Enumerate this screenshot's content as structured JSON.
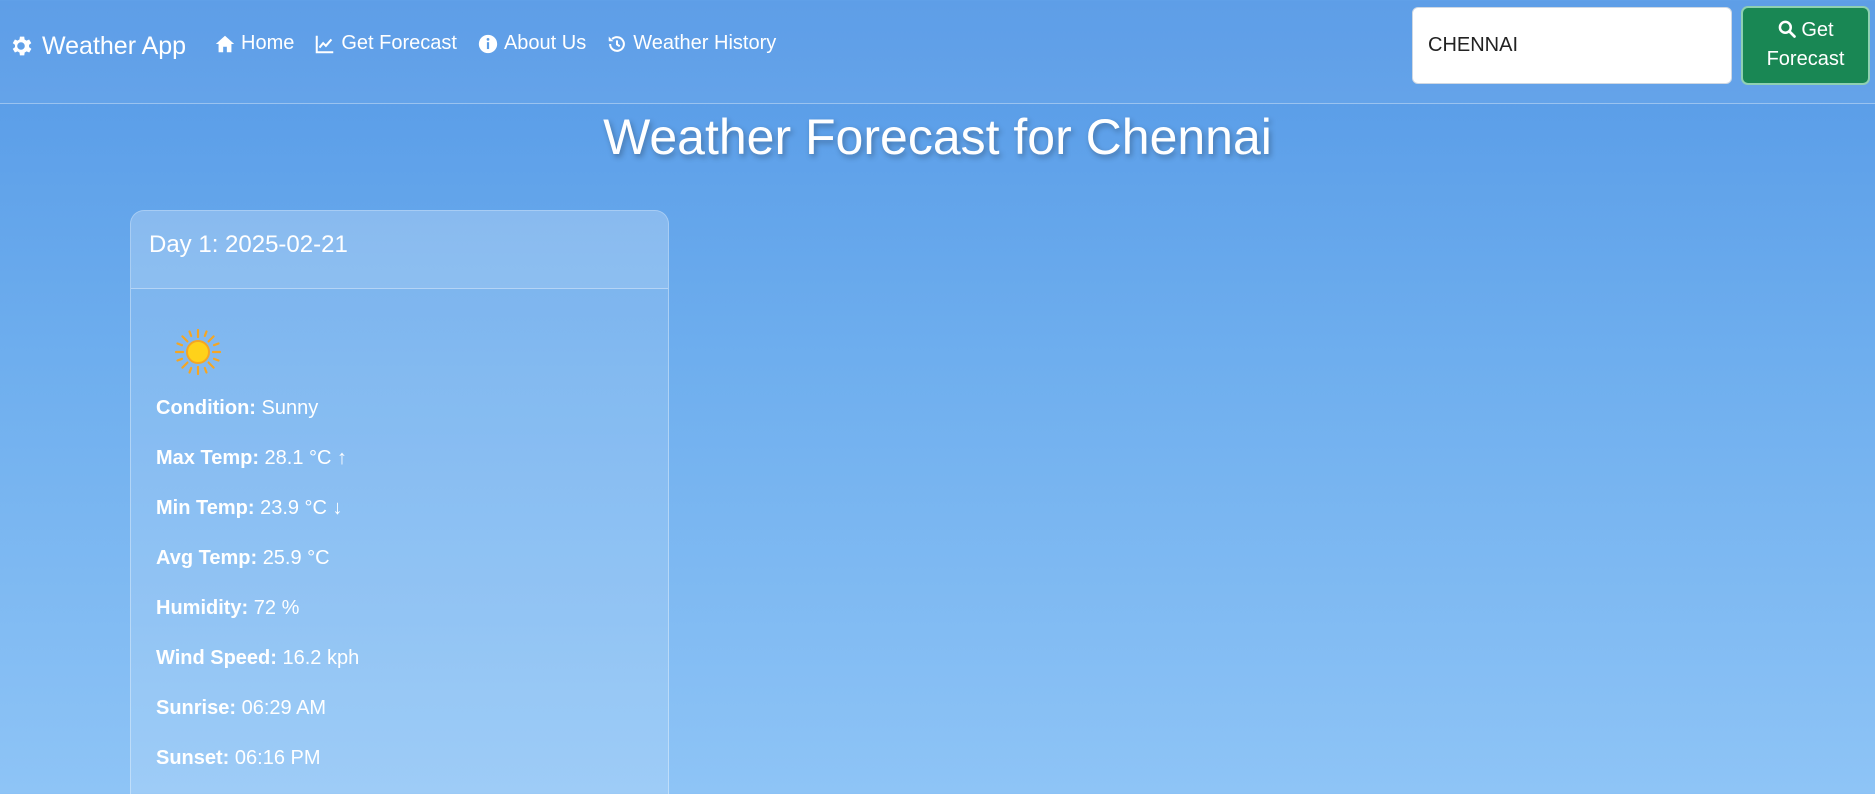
{
  "nav": {
    "brand": "Weather App",
    "links": [
      "Home",
      "Get Forecast",
      "About Us",
      "Weather History"
    ],
    "search_value": "CHENNAI",
    "button_label_line1": "Get",
    "button_label_line2": "Forecast"
  },
  "page": {
    "title": "Weather Forecast for Chennai"
  },
  "forecast": {
    "day_title": "Day 1: 2025-02-21",
    "icon": "sun-icon",
    "rows": [
      {
        "label": "Condition:",
        "value": "Sunny"
      },
      {
        "label": "Max Temp:",
        "value": "28.1 °C ↑"
      },
      {
        "label": "Min Temp:",
        "value": "23.9 °C ↓"
      },
      {
        "label": "Avg Temp:",
        "value": "25.9 °C"
      },
      {
        "label": "Humidity:",
        "value": "72 %"
      },
      {
        "label": "Wind Speed:",
        "value": "16.2 kph"
      },
      {
        "label": "Sunrise:",
        "value": "06:29 AM"
      },
      {
        "label": "Sunset:",
        "value": "06:16 PM"
      }
    ]
  },
  "colors": {
    "button_green": "#198754",
    "sun_yellow": "#ffd21a",
    "sun_orange": "#f5a623"
  }
}
